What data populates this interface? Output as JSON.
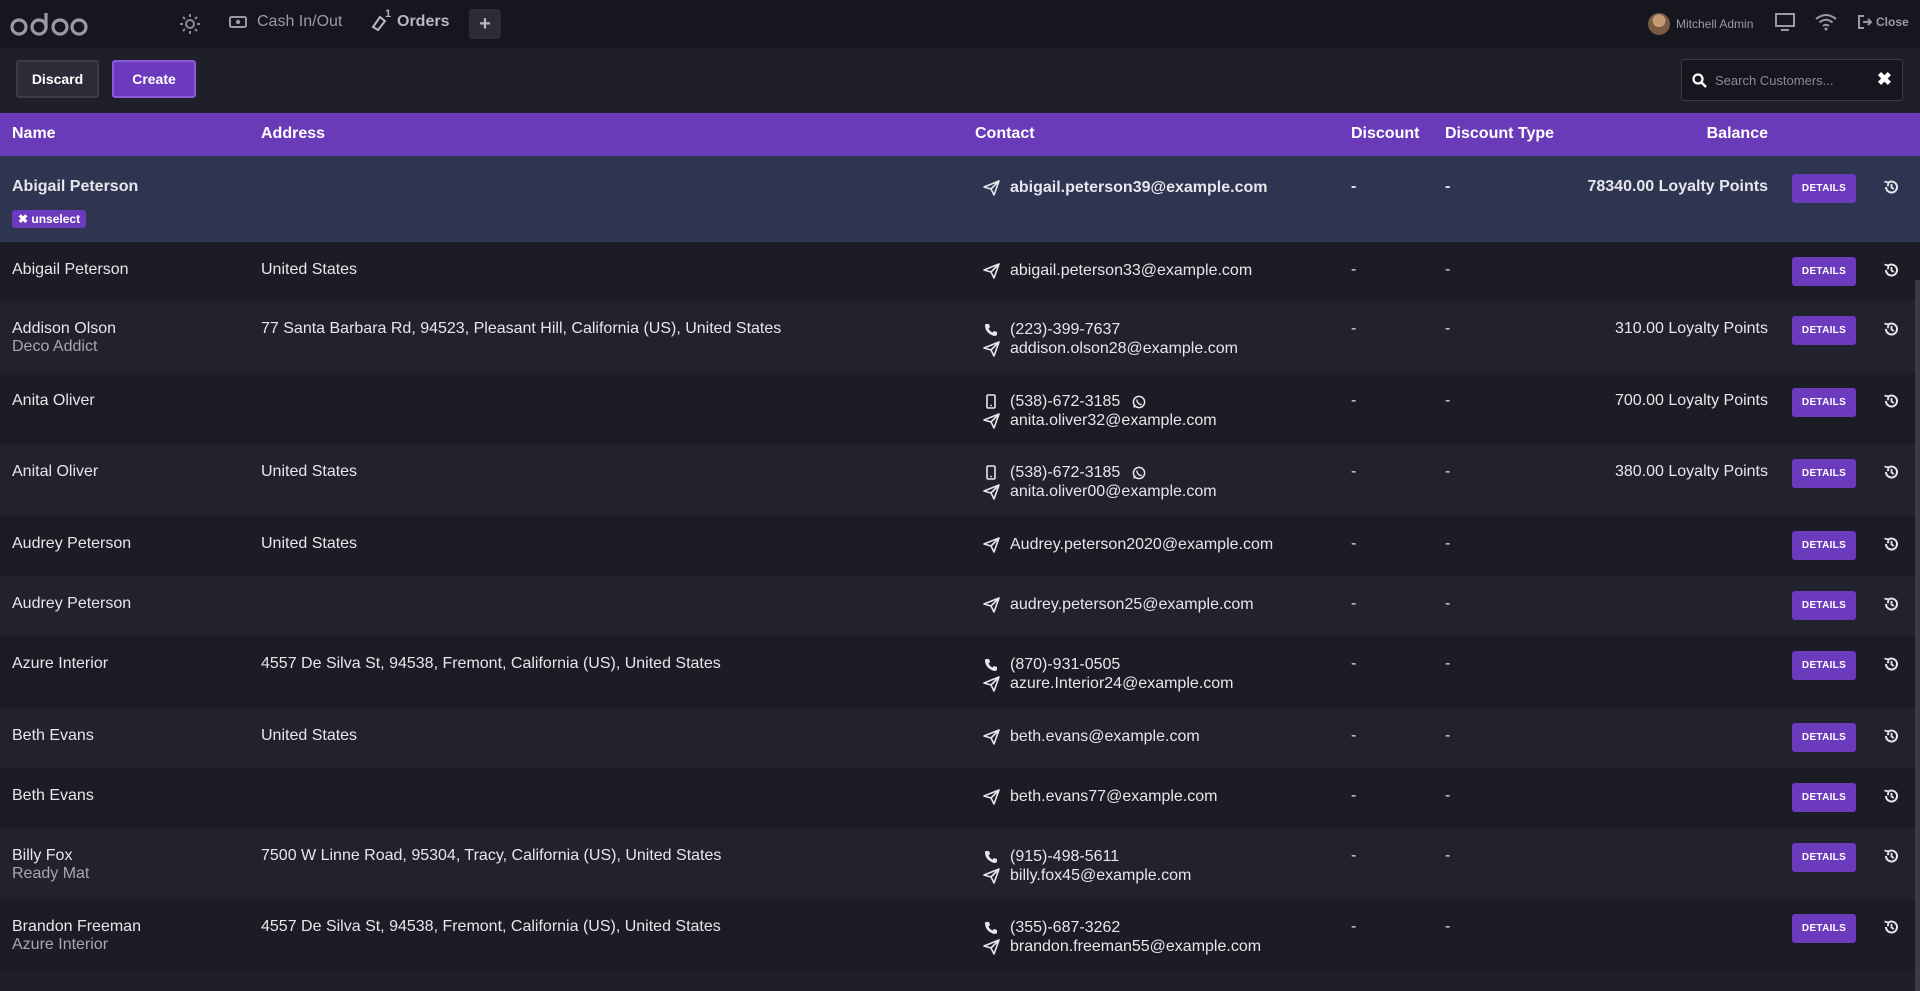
{
  "topbar": {
    "cash_label": "Cash In/Out",
    "orders_label": "Orders",
    "orders_count": "1",
    "plus_label": "+",
    "user_name": "Mitchell Admin",
    "close_label": "Close"
  },
  "toolbar": {
    "discard_label": "Discard",
    "create_label": "Create",
    "search_placeholder": "Search Customers...",
    "clear_label": "✖"
  },
  "table": {
    "headers": {
      "name": "Name",
      "address": "Address",
      "contact": "Contact",
      "discount": "Discount",
      "discount_type": "Discount Type",
      "balance": "Balance"
    },
    "details_label": "DETAILS",
    "unselect_label": "✖ unselect",
    "rows": [
      {
        "name": "Abigail Peterson",
        "company": "",
        "address": "",
        "phone": "",
        "mobile": "",
        "email": "abigail.peterson39@example.com",
        "discount": "-",
        "discount_type": "-",
        "balance": "78340.00 Loyalty Points"
      },
      {
        "name": "Abigail Peterson",
        "company": "",
        "address": "United States",
        "phone": "",
        "mobile": "",
        "email": "abigail.peterson33@example.com",
        "discount": "-",
        "discount_type": "-",
        "balance": ""
      },
      {
        "name": "Addison Olson",
        "company": "Deco Addict",
        "address": "77 Santa Barbara Rd, 94523, Pleasant Hill, California (US), United States",
        "phone": "(223)-399-7637",
        "mobile": "",
        "email": "addison.olson28@example.com",
        "discount": "-",
        "discount_type": "-",
        "balance": "310.00 Loyalty Points"
      },
      {
        "name": "Anita Oliver",
        "company": "",
        "address": "",
        "phone": "",
        "mobile": "(538)-672-3185",
        "email": "anita.oliver32@example.com",
        "discount": "-",
        "discount_type": "-",
        "balance": "700.00 Loyalty Points"
      },
      {
        "name": "Anital Oliver",
        "company": "",
        "address": "United States",
        "phone": "",
        "mobile": "(538)-672-3185",
        "email": "anita.oliver00@example.com",
        "discount": "-",
        "discount_type": "-",
        "balance": "380.00 Loyalty Points"
      },
      {
        "name": "Audrey Peterson",
        "company": "",
        "address": "United States",
        "phone": "",
        "mobile": "",
        "email": "Audrey.peterson2020@example.com",
        "discount": "-",
        "discount_type": "-",
        "balance": ""
      },
      {
        "name": "Audrey Peterson",
        "company": "",
        "address": "",
        "phone": "",
        "mobile": "",
        "email": "audrey.peterson25@example.com",
        "discount": "-",
        "discount_type": "-",
        "balance": ""
      },
      {
        "name": "Azure Interior",
        "company": "",
        "address": "4557 De Silva St, 94538, Fremont, California (US), United States",
        "phone": "(870)-931-0505",
        "mobile": "",
        "email": "azure.Interior24@example.com",
        "discount": "-",
        "discount_type": "-",
        "balance": ""
      },
      {
        "name": "Beth Evans",
        "company": "",
        "address": "United States",
        "phone": "",
        "mobile": "",
        "email": "beth.evans@example.com",
        "discount": "-",
        "discount_type": "-",
        "balance": ""
      },
      {
        "name": "Beth Evans",
        "company": "",
        "address": "",
        "phone": "",
        "mobile": "",
        "email": "beth.evans77@example.com",
        "discount": "-",
        "discount_type": "-",
        "balance": ""
      },
      {
        "name": "Billy Fox",
        "company": "Ready Mat",
        "address": "7500 W Linne Road, 95304, Tracy, California (US), United States",
        "phone": "(915)-498-5611",
        "mobile": "",
        "email": "billy.fox45@example.com",
        "discount": "-",
        "discount_type": "-",
        "balance": ""
      },
      {
        "name": "Brandon Freeman",
        "company": "Azure Interior",
        "address": "4557 De Silva St, 94538, Fremont, California (US), United States",
        "phone": "(355)-687-3262",
        "mobile": "",
        "email": "brandon.freeman55@example.com",
        "discount": "-",
        "discount_type": "-",
        "balance": ""
      }
    ]
  }
}
